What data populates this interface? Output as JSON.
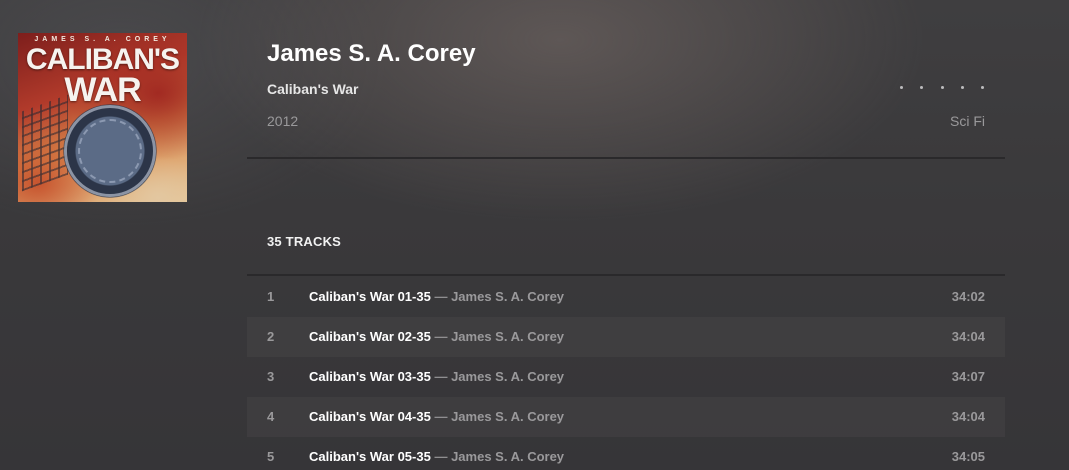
{
  "album_art": {
    "author_text": "JAMES S. A. COREY",
    "title_line1": "CALIBAN'S",
    "title_line2": "WAR"
  },
  "header": {
    "artist": "James S. A. Corey",
    "album": "Caliban's War",
    "year": "2012",
    "genre": "Sci Fi",
    "rating_stars": 0
  },
  "tracks_heading": "35 TRACKS",
  "tracks": [
    {
      "num": "1",
      "title": "Caliban's War 01-35",
      "sep": "—",
      "artist": "James S. A. Corey",
      "duration": "34:02"
    },
    {
      "num": "2",
      "title": "Caliban's War 02-35",
      "sep": "—",
      "artist": "James S. A. Corey",
      "duration": "34:04"
    },
    {
      "num": "3",
      "title": "Caliban's War 03-35",
      "sep": "—",
      "artist": "James S. A. Corey",
      "duration": "34:07"
    },
    {
      "num": "4",
      "title": "Caliban's War 04-35",
      "sep": "—",
      "artist": "James S. A. Corey",
      "duration": "34:04"
    },
    {
      "num": "5",
      "title": "Caliban's War 05-35",
      "sep": "—",
      "artist": "James S. A. Corey",
      "duration": "34:05"
    }
  ]
}
